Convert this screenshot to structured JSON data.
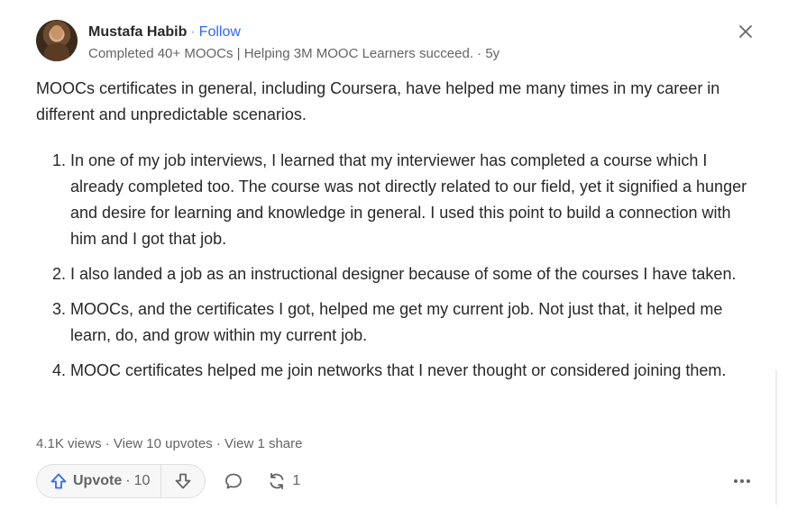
{
  "author": {
    "name": "Mustafa Habib",
    "separator": "·",
    "follow_label": "Follow",
    "credential": "Completed 40+ MOOCs | Helping 3M MOOC Learners succeed. · 5y"
  },
  "answer": {
    "intro": "MOOCs certificates in general, including Coursera, have helped me many times in my career in different and unpredictable scenarios.",
    "points": [
      "In one of my job interviews, I learned that my interviewer has completed a course which I already completed too. The course was not directly related to our field, yet it signified a hunger and desire for learning and knowledge in general. I used this point to build a connection with him and I got that job.",
      "I also landed a job as an instructional designer because of some of the courses I have taken.",
      "MOOCs, and the certificates I got, helped me get my current job. Not just that, it helped me learn, do, and grow within my current job.",
      "MOOC certificates helped me join networks that I never thought or considered joining them."
    ]
  },
  "stats": {
    "views": "4.1K views",
    "sep": " · ",
    "upvotes_link": "View 10 upvotes",
    "shares_link": "View 1 share"
  },
  "actions": {
    "upvote_label": "Upvote",
    "upvote_sep": "·",
    "upvote_count": "10",
    "share_count": "1"
  },
  "icons": {
    "close": "close-icon",
    "upvote": "arrow-up-icon",
    "downvote": "arrow-down-icon",
    "comment": "comment-icon",
    "share": "share-icon",
    "more": "more-icon"
  },
  "colors": {
    "accent": "#2e69ff",
    "text": "#282829",
    "muted": "#636466",
    "icon": "#2e69ff"
  }
}
